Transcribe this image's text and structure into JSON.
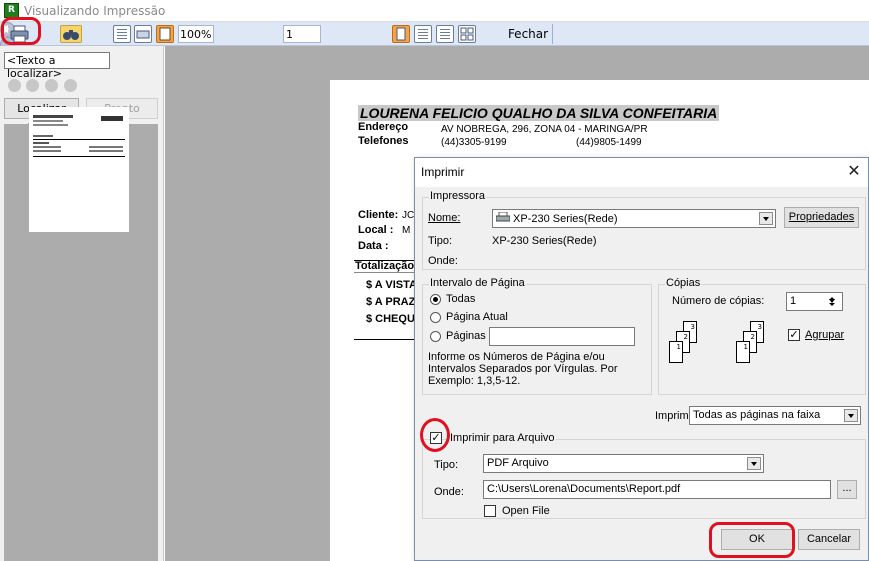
{
  "window": {
    "icon_letter": "R",
    "title": "Visualizando Impressão"
  },
  "toolbar": {
    "zoom": "100%",
    "page": "1",
    "close_label": "Fechar"
  },
  "left_panel": {
    "search_placeholder": "<Texto a localizar>",
    "find_text_label": "Localizar texto",
    "ready_label": "Pronto"
  },
  "document": {
    "company": "LOURENA FELICIO QUALHO DA SILVA CONFEITARIA",
    "address_label": "Endereço",
    "address_value": "AV NOBREGA, 296, ZONA 04 - MARINGA/PR",
    "phones_label": "Telefones",
    "phone_1": "(44)3305-9199",
    "phone_2": "(44)9805-1499",
    "client_label": "Cliente:",
    "client_value": "JC",
    "local_label": "Local :",
    "local_value": "M",
    "date_label": "Data :",
    "total_label": "Totalização",
    "lines": [
      "$ A VISTA",
      "$ A PRAZ",
      "$ CHEQUE"
    ]
  },
  "dialog": {
    "title": "Imprimir",
    "printer_group": "Impressora",
    "name_label": "Nome:",
    "printer_name": "XP-230 Series(Rede)",
    "properties_label": "Propriedades",
    "type_label": "Tipo:",
    "type_value": "XP-230 Series(Rede)",
    "where_label": "Onde:",
    "range_group": "Intervalo de Página",
    "range_all": "Todas",
    "range_current": "Página Atual",
    "range_pages": "Páginas",
    "range_hint": "Informe os Números de Página e/ou Intervalos Separados por Vírgulas. Por Exemplo: 1,3,5-12.",
    "copies_group": "Cópias",
    "copies_label": "Número de cópias:",
    "copies_value": "1",
    "collate_label": "Agrupar",
    "print_label": "Imprimir",
    "print_value": "Todas as páginas na faixa",
    "file_group": "Imprimir para Arquivo",
    "file_type_label": "Tipo:",
    "file_type_value": "PDF Arquivo",
    "file_where_label": "Onde:",
    "file_path": "C:\\Users\\Lorena\\Documents\\Report.pdf",
    "browse_label": "...",
    "open_file_label": "Open File",
    "ok_label": "OK",
    "cancel_label": "Cancelar"
  },
  "colors": {
    "annotation": "#e01020",
    "toolbar_bg": "#dde7f5",
    "preview_bg": "#acacac"
  }
}
